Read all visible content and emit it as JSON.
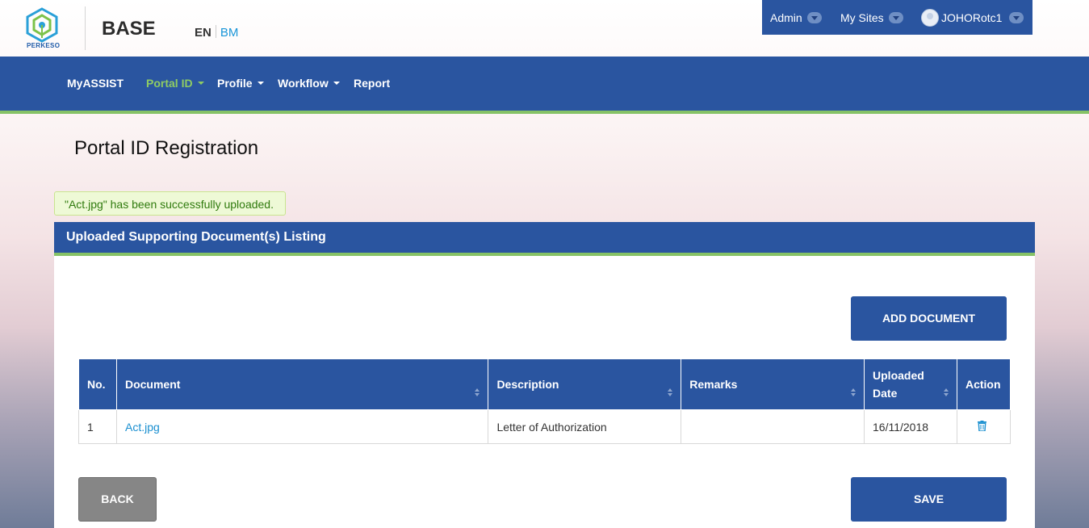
{
  "header": {
    "logo_text": "PERKESO",
    "brand": "BASE",
    "lang_en": "EN",
    "lang_bm": "BM"
  },
  "topbar": {
    "admin": "Admin",
    "my_sites": "My Sites",
    "user": "JOHORotc1"
  },
  "nav": {
    "items": [
      "MyASSIST",
      "Portal ID",
      "Profile",
      "Workflow",
      "Report"
    ],
    "active": "Portal ID"
  },
  "page": {
    "title": "Portal ID Registration",
    "alert": "\"Act.jpg\" has been successfully uploaded."
  },
  "panel": {
    "title": "Uploaded Supporting Document(s) Listing",
    "add_button": "ADD DOCUMENT",
    "back_button": "BACK",
    "save_button": "SAVE"
  },
  "table": {
    "columns": [
      "No.",
      "Document",
      "Description",
      "Remarks",
      "Uploaded Date",
      "Action"
    ],
    "rows": [
      {
        "no": "1",
        "document": "Act.jpg",
        "description": "Letter of Authorization",
        "remarks": "",
        "uploaded_date": "16/11/2018"
      }
    ]
  },
  "colors": {
    "primary": "#2a55a0",
    "accent_green": "#86c266",
    "link": "#1a8fd0"
  }
}
